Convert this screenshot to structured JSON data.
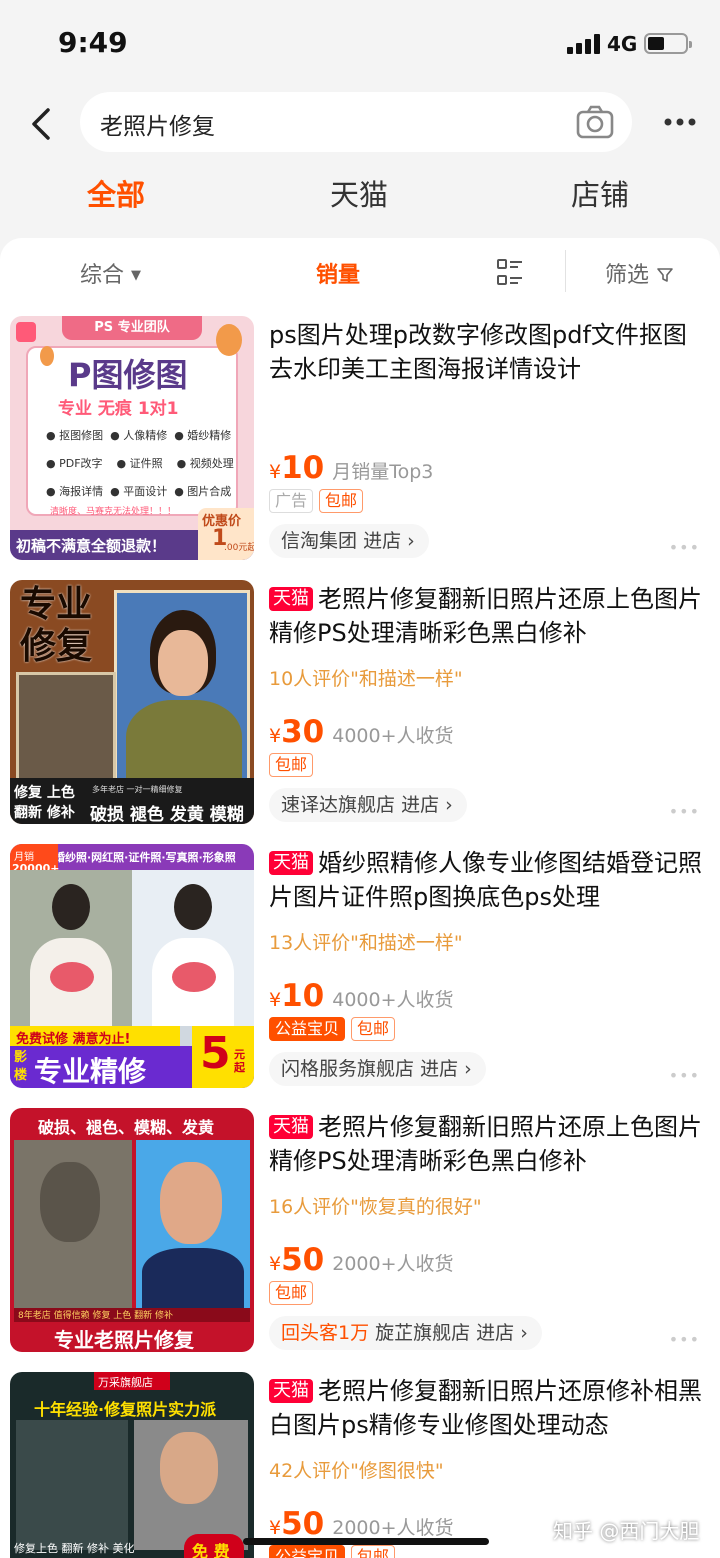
{
  "status_bar": {
    "time": "9:49",
    "network": "4G"
  },
  "search": {
    "query": "老照片修复"
  },
  "tabs": [
    {
      "label": "全部",
      "active": true
    },
    {
      "label": "天猫"
    },
    {
      "label": "店铺"
    }
  ],
  "sort": {
    "comprehensive": "综合",
    "sales": "销量",
    "filter": "筛选"
  },
  "products": [
    {
      "title": "ps图片处理p改数字修改图pdf文件抠图去水印美工主图海报详情设计",
      "tmall": false,
      "review": "",
      "price": "10",
      "sales": "月销量Top3",
      "tags": [
        "广告",
        "包邮"
      ],
      "shop_prefix": "",
      "shop": "信淘集团",
      "enter": "进店",
      "thumb_text": {
        "team": "PS 专业团队",
        "headline": "P图修图",
        "sub": "专业 无痕 1对1",
        "items": [
          "抠图修图",
          "人像精修",
          "婚纱精修",
          "PDF改字",
          "证件照",
          "视频处理",
          "海报详情",
          "平面设计",
          "图片合成"
        ],
        "note": "清晰度、马赛克无法处理！！！",
        "refund": "初稿不满意全额退款！",
        "discount": "优惠价",
        "discount_price": "1",
        "unit": ".00元起"
      }
    },
    {
      "title": "老照片修复翻新旧照片还原上色图片精修PS处理清晰彩色黑白修补",
      "tmall": true,
      "review": "10人评价\"和描述一样\"",
      "price": "30",
      "sales": "4000+人收货",
      "tags": [
        "包邮"
      ],
      "shop_prefix": "",
      "shop": "速译达旗舰店",
      "enter": "进店",
      "thumb_text": {
        "line1": "专业",
        "line2": "修复",
        "badge1": "修复 上色",
        "badge2": "翻新 修补",
        "small": "多年老店 一对一精细修复",
        "big": "破损 褪色 发黄 模糊"
      }
    },
    {
      "title": "婚纱照精修人像专业修图结婚登记照片图片证件照p图换底色ps处理",
      "tmall": true,
      "review": "13人评价\"和描述一样\"",
      "price": "10",
      "sales": "4000+人收货",
      "tags": [
        "公益宝贝",
        "包邮"
      ],
      "shop_prefix": "",
      "shop": "闪格服务旗舰店",
      "enter": "进店",
      "thumb_text": {
        "top": "婚纱照·网红照·证件照·写真照·形象照",
        "corner1": "月销",
        "corner2": "20000+",
        "trial": "免费试修 满意为止!",
        "studio1": "影",
        "studio2": "楼",
        "big": "专业精修",
        "price": "5",
        "unit": "元起"
      }
    },
    {
      "title": "老照片修复翻新旧照片还原上色图片精修PS处理清晰彩色黑白修补",
      "tmall": true,
      "review": "16人评价\"恢复真的很好\"",
      "price": "50",
      "sales": "2000+人收货",
      "tags": [
        "包邮"
      ],
      "shop_prefix": "回头客1万",
      "shop": "旋芷旗舰店",
      "enter": "进店",
      "thumb_text": {
        "top": "破损、褪色、模糊、发黄",
        "badge": "8年老店 值得信赖  修复 上色 翻新 修补",
        "bottom": "专业老照片修复"
      }
    },
    {
      "title": "老照片修复翻新旧照片还原修补相黑白图片ps精修专业修图处理动态",
      "tmall": true,
      "review": "42人评价\"修图很快\"",
      "price": "50",
      "sales": "2000+人收货",
      "tags": [
        "公益宝贝",
        "包邮"
      ],
      "shop_prefix": "",
      "shop": "",
      "enter": "",
      "thumb_text": {
        "shop": "万采旗舰店",
        "top": "十年经验·修复照片实力派",
        "bottom": "修复上色 翻新 修补 美化",
        "free": "免 费"
      }
    }
  ],
  "watermark": "知乎 @西门大胆",
  "colors": {
    "accent": "#ff5000",
    "tmall": "#ff0036",
    "review": "#e89b3c"
  }
}
